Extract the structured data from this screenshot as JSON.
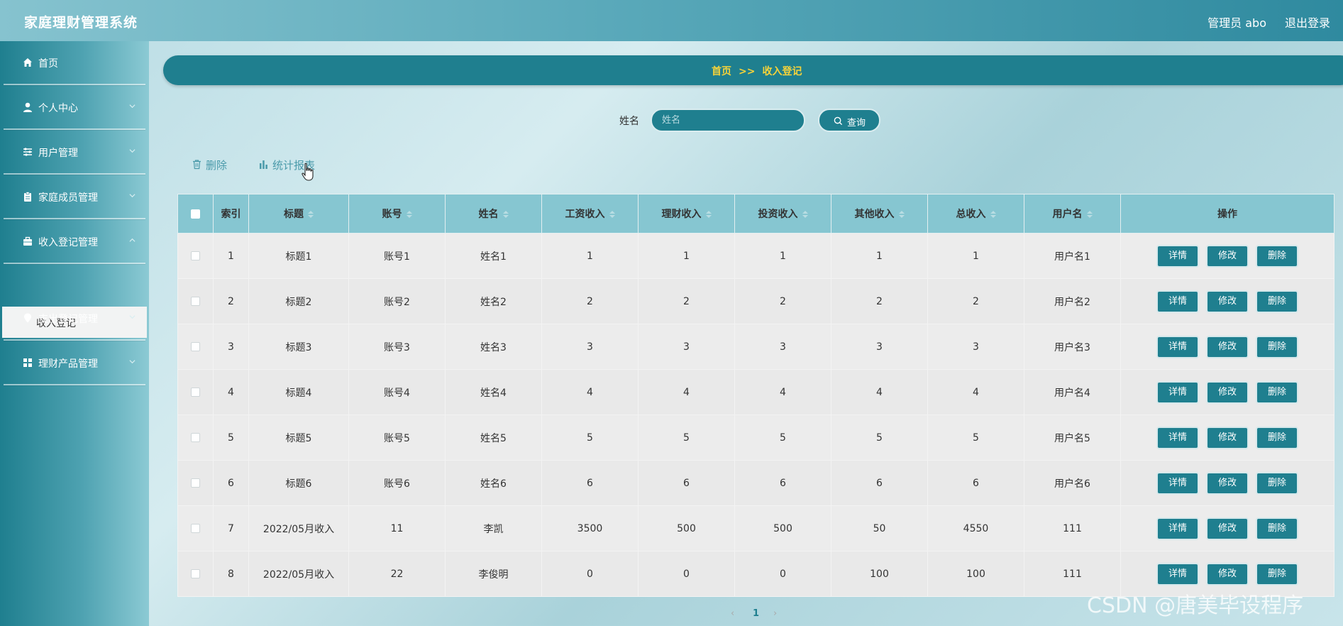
{
  "header": {
    "title": "家庭理财管理系统",
    "admin": "管理员 abo",
    "logout": "退出登录"
  },
  "sidebar": {
    "items": [
      {
        "label": "首页",
        "icon": "home-icon"
      },
      {
        "label": "个人中心",
        "icon": "user-icon"
      },
      {
        "label": "用户管理",
        "icon": "sliders-icon"
      },
      {
        "label": "家庭成员管理",
        "icon": "clipboard-icon"
      },
      {
        "label": "收入登记管理",
        "icon": "briefcase-icon"
      },
      {
        "label": "支出登记管理",
        "icon": "pin-icon"
      },
      {
        "label": "理财产品管理",
        "icon": "grid-icon"
      }
    ],
    "active_sub": "收入登记"
  },
  "breadcrumb": {
    "home": "首页",
    "sep": ">>",
    "current": "收入登记"
  },
  "search": {
    "label": "姓名",
    "placeholder": "姓名",
    "button": "查询"
  },
  "toolbar": {
    "delete": "删除",
    "report": "统计报表"
  },
  "table": {
    "headers": [
      "索引",
      "标题",
      "账号",
      "姓名",
      "工资收入",
      "理财收入",
      "投资收入",
      "其他收入",
      "总收入",
      "用户名",
      "操作"
    ],
    "rows": [
      [
        "1",
        "标题1",
        "账号1",
        "姓名1",
        "1",
        "1",
        "1",
        "1",
        "1",
        "用户名1"
      ],
      [
        "2",
        "标题2",
        "账号2",
        "姓名2",
        "2",
        "2",
        "2",
        "2",
        "2",
        "用户名2"
      ],
      [
        "3",
        "标题3",
        "账号3",
        "姓名3",
        "3",
        "3",
        "3",
        "3",
        "3",
        "用户名3"
      ],
      [
        "4",
        "标题4",
        "账号4",
        "姓名4",
        "4",
        "4",
        "4",
        "4",
        "4",
        "用户名4"
      ],
      [
        "5",
        "标题5",
        "账号5",
        "姓名5",
        "5",
        "5",
        "5",
        "5",
        "5",
        "用户名5"
      ],
      [
        "6",
        "标题6",
        "账号6",
        "姓名6",
        "6",
        "6",
        "6",
        "6",
        "6",
        "用户名6"
      ],
      [
        "7",
        "2022/05月收入",
        "11",
        "李凯",
        "3500",
        "500",
        "500",
        "50",
        "4550",
        "111"
      ],
      [
        "8",
        "2022/05月收入",
        "22",
        "李俊明",
        "0",
        "0",
        "0",
        "100",
        "100",
        "111"
      ]
    ],
    "actions": [
      "详情",
      "修改",
      "删除"
    ]
  },
  "pagination": {
    "prev": "‹",
    "current": "1",
    "next": "›"
  },
  "watermark": "CSDN @唐美毕设程序",
  "colors": {
    "primary": "#1f7f8f",
    "header_row": "#86c6d1",
    "breadcrumb_text": "#f6d33a"
  }
}
